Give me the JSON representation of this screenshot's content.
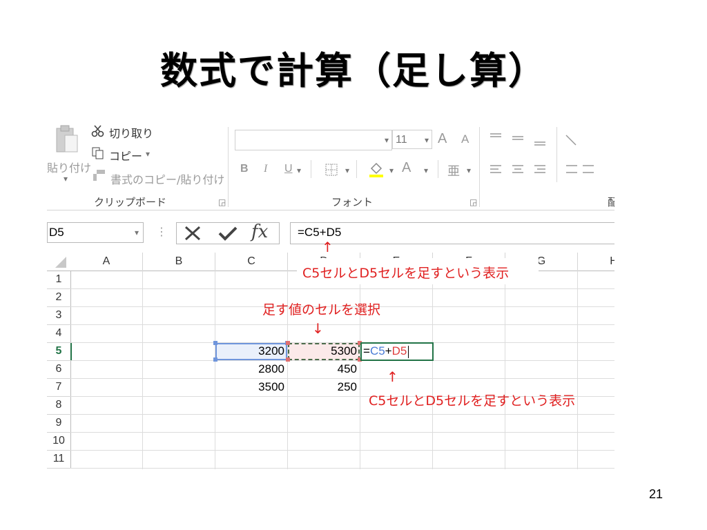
{
  "slide": {
    "title": "数式で計算（足し算）",
    "page_number": "21"
  },
  "ribbon": {
    "clipboard": {
      "paste_label": "貼り付け",
      "cut_label": "切り取り",
      "copy_label": "コピー",
      "format_painter_label": "書式のコピー/貼り付け",
      "group_label": "クリップボード"
    },
    "font": {
      "font_name": "",
      "font_size": "11",
      "grow_label": "A",
      "shrink_label": "A",
      "bold_label": "B",
      "italic_label": "I",
      "underline_label": "U",
      "font_color_label": "A",
      "phonetic_label": "亜",
      "group_label": "フォント"
    },
    "next_group_fragment": "配"
  },
  "formula_bar": {
    "name_box": "D5",
    "formula": "=C5+D5"
  },
  "grid": {
    "columns": [
      "A",
      "B",
      "C",
      "D",
      "E",
      "F",
      "G",
      "H"
    ],
    "rows": [
      "1",
      "2",
      "3",
      "4",
      "5",
      "6",
      "7",
      "8",
      "9",
      "10",
      "11"
    ],
    "cells": {
      "C5": "3200",
      "D5": "5300",
      "C6": "2800",
      "D6": "450",
      "C7": "3500",
      "D7": "250"
    },
    "editing_cell": {
      "eq": "=",
      "ref1": "C5",
      "plus": "+",
      "ref2": "D5"
    }
  },
  "callouts": {
    "top": "C5セルとD5セルを足すという表示",
    "middle": "足す値のセルを選択",
    "bottom": "C5セルとD5セルを足すという表示",
    "arrow_up": "↑",
    "arrow_down": "↓"
  },
  "colors": {
    "ref1_blue": "#4a7cd6",
    "ref2_red": "#e04040",
    "active_green": "#217346",
    "callout_red": "#e02020"
  }
}
